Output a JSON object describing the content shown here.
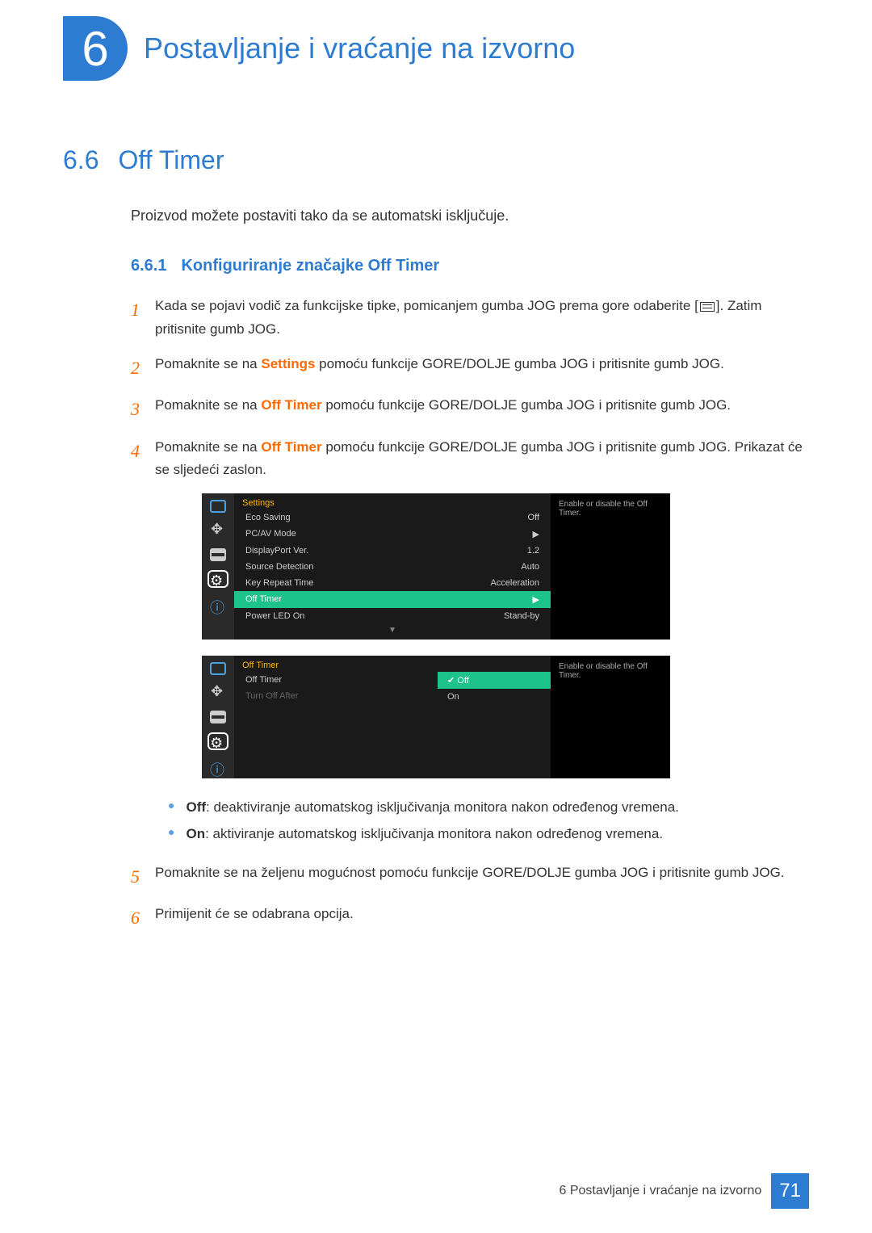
{
  "chapter": {
    "number": "6",
    "title": "Postavljanje i vraćanje na izvorno"
  },
  "section": {
    "number": "6.6",
    "title": "Off Timer"
  },
  "intro": "Proizvod možete postaviti tako da se automatski isključuje.",
  "subsection": {
    "number": "6.6.1",
    "title": "Konfiguriranje značajke Off Timer"
  },
  "steps": {
    "s1a": "Kada se pojavi vodič za funkcijske tipke, pomicanjem gumba JOG prema gore odaberite [",
    "s1b": "]. Zatim pritisnite gumb JOG.",
    "s2a": "Pomaknite se na ",
    "s2b": "Settings",
    "s2c": " pomoću funkcije GORE/DOLJE gumba JOG i pritisnite gumb JOG.",
    "s3a": "Pomaknite se na ",
    "s3b": "Off Timer",
    "s3c": " pomoću funkcije GORE/DOLJE gumba JOG i pritisnite gumb JOG.",
    "s4a": "Pomaknite se na ",
    "s4b": "Off Timer",
    "s4c": " pomoću funkcije GORE/DOLJE gumba JOG i pritisnite gumb JOG. Prikazat će se sljedeći zaslon.",
    "s5": "Pomaknite se na željenu mogućnost pomoću funkcije GORE/DOLJE gumba JOG i pritisnite gumb JOG.",
    "s6": "Primijenit će se odabrana opcija."
  },
  "step_numbers": {
    "n1": "1",
    "n2": "2",
    "n3": "3",
    "n4": "4",
    "n5": "5",
    "n6": "6"
  },
  "osd1": {
    "title": "Settings",
    "hint": "Enable or disable the Off Timer.",
    "rows": {
      "r1l": "Eco Saving",
      "r1v": "Off",
      "r2l": "PC/AV Mode",
      "r2v": "▶",
      "r3l": "DisplayPort Ver.",
      "r3v": "1.2",
      "r4l": "Source Detection",
      "r4v": "Auto",
      "r5l": "Key Repeat Time",
      "r5v": "Acceleration",
      "r6l": "Off Timer",
      "r6v": "▶",
      "r7l": "Power LED On",
      "r7v": "Stand-by"
    }
  },
  "osd2": {
    "title": "Off Timer",
    "hint": "Enable or disable the Off Timer.",
    "rows": {
      "r1l": "Off Timer",
      "r2l": "Turn Off After"
    },
    "opts": {
      "o1": "Off",
      "o2": "On"
    }
  },
  "bullets": {
    "b1l": "Off",
    "b1t": ": deaktiviranje automatskog isključivanja monitora nakon određenog vremena.",
    "b2l": "On",
    "b2t": ": aktiviranje automatskog isključivanja monitora nakon određenog vremena."
  },
  "footer": {
    "chapter_label": "6 Postavljanje i vraćanje na izvorno",
    "page": "71"
  }
}
